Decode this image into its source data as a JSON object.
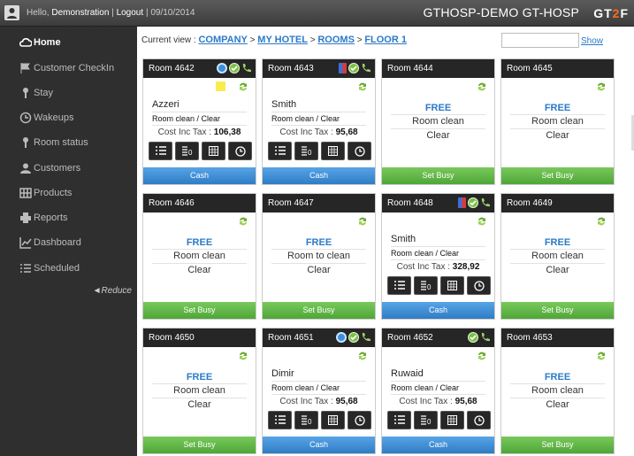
{
  "topbar": {
    "hello": "Hello,",
    "user": "Demonstration",
    "logout": "Logout",
    "sep1": "|",
    "sep2": "|",
    "date": "09/10/2014",
    "brand": "GTHOSP-DEMO GT-HOSP",
    "logo_a": "GT",
    "logo_b": "2",
    "logo_c": "F"
  },
  "sidebar": {
    "items": [
      {
        "label": "Home",
        "icon": "cloud-icon"
      },
      {
        "label": "Customer CheckIn",
        "icon": "flag-icon"
      },
      {
        "label": "Stay",
        "icon": "key-icon"
      },
      {
        "label": "Wakeups",
        "icon": "clock-icon"
      },
      {
        "label": "Room status",
        "icon": "key-icon"
      },
      {
        "label": "Customers",
        "icon": "user-icon"
      },
      {
        "label": "Products",
        "icon": "grid-icon"
      },
      {
        "label": "Reports",
        "icon": "printer-icon"
      },
      {
        "label": "Dashboard",
        "icon": "chart-icon"
      },
      {
        "label": "Scheduled",
        "icon": "list-icon"
      }
    ],
    "reduce": "◄Reduce"
  },
  "crumbs": {
    "prefix": "Current view :",
    "company": "COMPANY",
    "hotel": "MY HOTEL",
    "rooms": "ROOMS",
    "floor": "FLOOR 1",
    "sep": ">"
  },
  "search": {
    "placeholder": "",
    "show": "Show"
  },
  "colors": {
    "accent": "#2b7ac9",
    "cash": "#3a8ad6",
    "busy": "#5cb443",
    "header": "#262626"
  },
  "cost_label": "Cost Inc Tax :",
  "rooms": [
    {
      "name": "Room 4642",
      "state": "occupied",
      "guest": "Azzeri",
      "status": "Room clean / Clear",
      "cost": "106,38",
      "button": "Cash",
      "icons": [
        "blue",
        "green",
        "phone"
      ],
      "note": true
    },
    {
      "name": "Room 4643",
      "state": "occupied",
      "guest": "Smith",
      "status": "Room clean / Clear",
      "cost": "95,68",
      "button": "Cash",
      "icons": [
        "flag",
        "green",
        "phone"
      ]
    },
    {
      "name": "Room 4644",
      "state": "free",
      "free": "FREE",
      "c1": "Room clean",
      "c2": "Clear",
      "button": "Set Busy",
      "icons": []
    },
    {
      "name": "Room 4645",
      "state": "free",
      "free": "FREE",
      "c1": "Room clean",
      "c2": "Clear",
      "button": "Set Busy",
      "icons": []
    },
    {
      "name": "Room 4646",
      "state": "free",
      "free": "FREE",
      "c1": "Room clean",
      "c2": "Clear",
      "button": "Set Busy",
      "icons": []
    },
    {
      "name": "Room 4647",
      "state": "free",
      "free": "FREE",
      "c1": "Room to clean",
      "c2": "Clear",
      "button": "Set Busy",
      "icons": []
    },
    {
      "name": "Room 4648",
      "state": "occupied",
      "guest": "Smith",
      "status": "Room clean / Clear",
      "cost": "328,92",
      "button": "Cash",
      "icons": [
        "flag",
        "green",
        "phone"
      ]
    },
    {
      "name": "Room 4649",
      "state": "free",
      "free": "FREE",
      "c1": "Room clean",
      "c2": "Clear",
      "button": "Set Busy",
      "icons": []
    },
    {
      "name": "Room 4650",
      "state": "free",
      "free": "FREE",
      "c1": "Room clean",
      "c2": "Clear",
      "button": "Set Busy",
      "icons": []
    },
    {
      "name": "Room 4651",
      "state": "occupied",
      "guest": "Dimir",
      "status": "Room clean / Clear",
      "cost": "95,68",
      "button": "Cash",
      "icons": [
        "blue",
        "green",
        "phone"
      ]
    },
    {
      "name": "Room 4652",
      "state": "occupied",
      "guest": "Ruwaid",
      "status": "Room clean / Clear",
      "cost": "95,68",
      "button": "Cash",
      "icons": [
        "green",
        "phone"
      ]
    },
    {
      "name": "Room 4653",
      "state": "free",
      "free": "FREE",
      "c1": "Room clean",
      "c2": "Clear",
      "button": "Set Busy",
      "icons": []
    }
  ]
}
